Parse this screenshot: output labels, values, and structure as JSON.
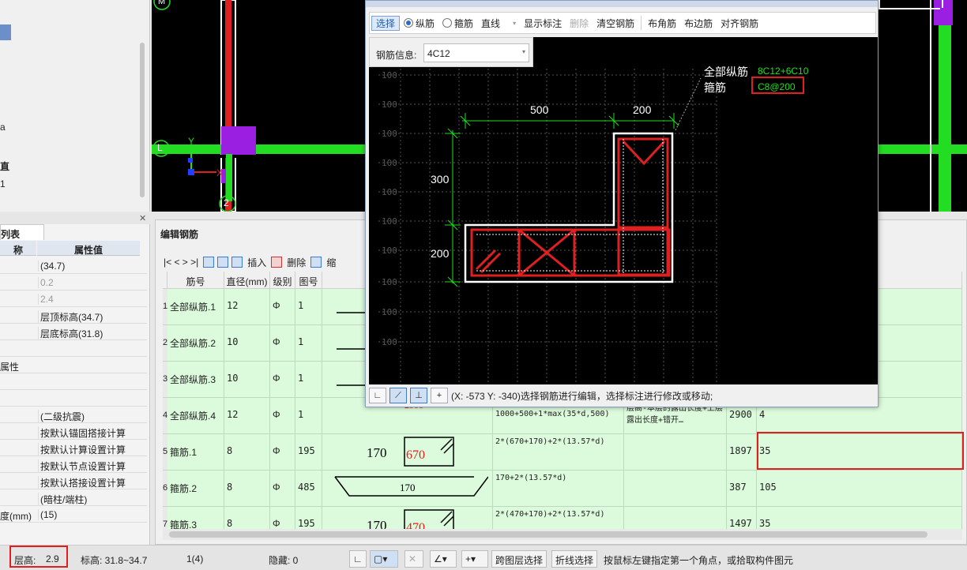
{
  "left_top": {
    "items": [
      "a",
      "直",
      "1"
    ]
  },
  "cad_top": {
    "marker_m": "M",
    "marker_l": "L",
    "marker_2": "2",
    "axis_x": "X",
    "axis_y": "Y"
  },
  "properties": {
    "tab": "列表",
    "col_name": "称",
    "col_value": "属性值",
    "rows": [
      {
        "name": "",
        "value": "(34.7)",
        "gray": false
      },
      {
        "name": "",
        "value": "0.2",
        "gray": true
      },
      {
        "name": "",
        "value": "2.4",
        "gray": true
      },
      {
        "name": "",
        "value": "层顶标高(34.7)",
        "gray": false
      },
      {
        "name": "",
        "value": "层底标高(31.8)",
        "gray": false
      },
      {
        "name": "",
        "value": "",
        "gray": false
      },
      {
        "name": "属性",
        "value": "",
        "gray": false
      },
      {
        "name": "",
        "value": "",
        "gray": false
      },
      {
        "name": "",
        "value": "",
        "gray": false
      },
      {
        "name": "",
        "value": "(二级抗震)",
        "gray": false
      },
      {
        "name": "",
        "value": "按默认锚固搭接计算",
        "gray": false
      },
      {
        "name": "",
        "value": "按默认计算设置计算",
        "gray": false
      },
      {
        "name": "",
        "value": "按默认节点设置计算",
        "gray": false
      },
      {
        "name": "",
        "value": "按默认搭接设置计算",
        "gray": false
      },
      {
        "name": "",
        "value": "(暗柱/端柱)",
        "gray": false
      },
      {
        "name": "度(mm)",
        "value": "(15)",
        "gray": false
      }
    ]
  },
  "edit_panel": {
    "title": "编辑钢筋",
    "nav": "|<  <  >  >|",
    "insert": "插入",
    "delete": "删除",
    "more": "缩"
  },
  "grid": {
    "headers": [
      "筋号",
      "直径(mm)",
      "级别",
      "图号"
    ],
    "grade_symbol": "Φ",
    "rows": [
      {
        "num": "1",
        "name": "全部纵筋.1",
        "dia": "12",
        "fig": "1",
        "formula": "",
        "note": "",
        "len": "",
        "qty": ""
      },
      {
        "num": "2",
        "name": "全部纵筋.2",
        "dia": "10",
        "fig": "1",
        "formula": "",
        "note": "",
        "len": "",
        "qty": ""
      },
      {
        "num": "3",
        "name": "全部纵筋.3",
        "dia": "10",
        "fig": "1",
        "formula": "",
        "note": "",
        "len": "",
        "qty": ""
      },
      {
        "num": "4",
        "name": "全部纵筋.4",
        "dia": "12",
        "fig": "1",
        "formula": "2900-1000+500+1*max(35*d,500)",
        "note": "层高-本层的露出长度+上层露出长度+错开…",
        "len": "2900",
        "qty": "4"
      },
      {
        "num": "5",
        "name": "箍筋.1",
        "dia": "8",
        "fig": "195",
        "formula": "2*(670+170)+2*(13.57*d)",
        "note": "",
        "len": "1897",
        "qty": "35"
      },
      {
        "num": "6",
        "name": "箍筋.2",
        "dia": "8",
        "fig": "485",
        "formula": "170+2*(13.57*d)",
        "note": "",
        "len": "387",
        "qty": "105"
      },
      {
        "num": "7",
        "name": "箍筋.3",
        "dia": "8",
        "fig": "195",
        "formula": "2*(470+170)+2*(13.57*d)",
        "note": "",
        "len": "1497",
        "qty": "35"
      }
    ],
    "shape_r4": "2900",
    "shape_r5_a": "170",
    "shape_r5_b": "670",
    "shape_r6": "170",
    "shape_r7_a": "170",
    "shape_r7_b": "470"
  },
  "dialog": {
    "toolbar": {
      "select": "选择",
      "longitudinal": "纵筋",
      "stirrup": "箍筋",
      "line": "直线",
      "show_dims": "显示标注",
      "delete": "删除",
      "clear": "清空钢筋",
      "corner": "布角筋",
      "edge": "布边筋",
      "align": "对齐钢筋"
    },
    "info_label": "钢筋信息:",
    "info_value": "4C12",
    "all_long_label": "全部纵筋",
    "all_long_value": "8C12+6C10",
    "stirrup_label": "箍筋",
    "stirrup_value": "C8@200",
    "dim_500": "500",
    "dim_200_top": "200",
    "dim_300": "300",
    "dim_200_left": "200",
    "grid_label": "100",
    "status_text": "(X: -573 Y: -340)选择钢筋进行编辑，选择标注进行修改或移动;"
  },
  "status": {
    "floor_height_label": "层高:",
    "floor_height": "2.9",
    "elevation": "标高:   31.8~34.7",
    "floor": "1(4)",
    "hidden": "隐藏:  0",
    "cross_layer": "跨图层选择",
    "polyline": "折线选择",
    "hint": "按鼠标左键指定第一个角点，或拾取构件图元"
  },
  "colors": {
    "green": "#22dd22",
    "purple": "#9b1fe0",
    "red": "#e02020",
    "accent": "#3a7ad0"
  }
}
